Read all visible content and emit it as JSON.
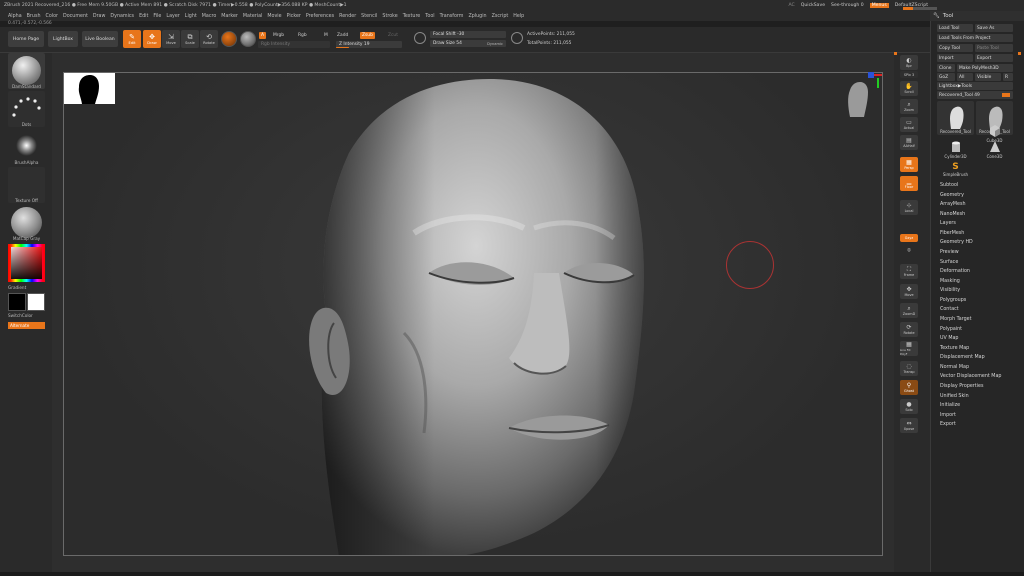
{
  "title_bar": {
    "text": "ZBrush 2021   Recovered_216   ● Free Mem 9.50GB ● Active Mem 891 ● Scratch Disk 7971 ● Timer▶0.558 ● PolyCount▶356.088 KP ● MeshCount▶1",
    "ac": "AC",
    "quicksave": "QuickSave",
    "see_through": "See-through  0",
    "menus": "Menus",
    "default_zscript": "DefaultZScript"
  },
  "menu_bar": [
    "Alpha",
    "Brush",
    "Color",
    "Document",
    "Draw",
    "Dynamics",
    "Edit",
    "File",
    "Layer",
    "Light",
    "Macro",
    "Marker",
    "Material",
    "Movie",
    "Picker",
    "Preferences",
    "Render",
    "Stencil",
    "Stroke",
    "Texture",
    "Tool",
    "Transform",
    "Zplugin",
    "Zscript",
    "Help"
  ],
  "coords": "0.471,-0.572,-0.566",
  "top_shelf": {
    "home_page": "Home Page",
    "lightbox": "LightBox",
    "live_boolean": "Live Boolean",
    "edit": "Edit",
    "draw": "Draw",
    "move": "Move",
    "scale": "Scale",
    "rotate": "Rotate",
    "a": "A",
    "mrgb": "Mrgb",
    "rgb": "Rgb",
    "m": "M",
    "rgb_intensity": "Rgb Intensity",
    "zadd": "Zadd",
    "zsub": "Zsub",
    "zcut": "Zcut",
    "z_intensity": "Z Intensity 19",
    "z_intensity_value": 19,
    "focal_shift": "Focal Shift -30",
    "draw_size": "Draw Size 54",
    "dynamic": "Dynamic",
    "active_points": "ActivePoints: 211,055",
    "total_points": "TotalPoints: 211,055"
  },
  "left_shelf": {
    "brush": "DamStandard",
    "stroke": "Dots",
    "alpha": "BrushAlpha",
    "texture": "Texture Off",
    "material": "MatCap Gray",
    "gradient": "Gradient",
    "switch_color": "SwitchColor",
    "alternate": "Alternate"
  },
  "right_shelf": [
    "Bpr",
    "SPix 3",
    "Scroll",
    "Zoom",
    "Actual",
    "AAHalf",
    "Persp",
    "Floor",
    "Local",
    "Gxyz",
    "",
    "",
    "Frame",
    "Move",
    "ZoomD",
    "Rotate",
    "Line Fill PolyF",
    "Transp",
    "Ghost",
    "Solo",
    "Xpose"
  ],
  "tool_panel": {
    "title": "Tool",
    "load_tool": "Load Tool",
    "save_as": "Save As",
    "load_from_project": "Load Tools From Project",
    "copy_tool": "Copy Tool",
    "paste_tool": "Paste Tool",
    "import": "Import",
    "export": "Export",
    "clone": "Clone",
    "make_polymesh": "Make PolyMesh3D",
    "goz": "GoZ",
    "all": "All",
    "visible": "Visible",
    "r": "R",
    "lightbox_tools": "Lightbox▶Tools",
    "current_tool": "Recovered_Tool  49",
    "current_tool_value": 49,
    "grid": [
      "Recovered_Tool",
      "Recovered_Tool",
      "",
      "Cube3D",
      "Cylinder3D",
      "Cone3D",
      "SimpleBrush"
    ],
    "subpalettes": [
      "Subtool",
      "Geometry",
      "ArrayMesh",
      "NanoMesh",
      "Layers",
      "FiberMesh",
      "Geometry HD",
      "Preview",
      "Surface",
      "Deformation",
      "Masking",
      "Visibility",
      "Polygroups",
      "Contact",
      "Morph Target",
      "Polypaint",
      "UV Map",
      "Texture Map",
      "Displacement Map",
      "Normal Map",
      "Vector Displacement Map",
      "Display Properties",
      "Unified Skin",
      "Initialize",
      "Import",
      "Export"
    ]
  }
}
